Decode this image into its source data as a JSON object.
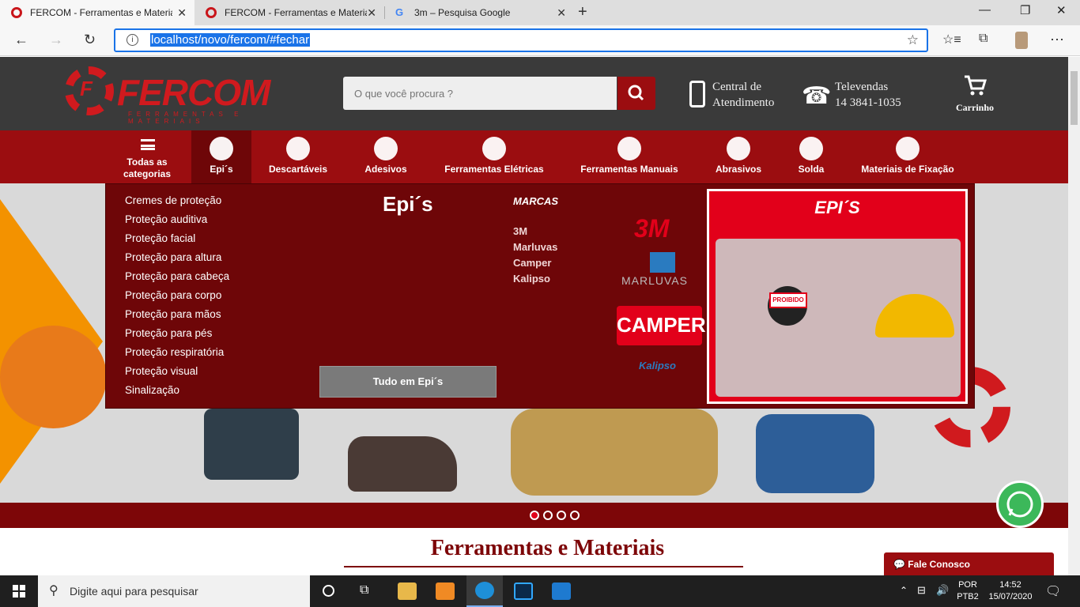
{
  "browser": {
    "tabs": [
      {
        "title": "FERCOM - Ferramentas e Materiais"
      },
      {
        "title": "FERCOM - Ferramentas e Materiais"
      },
      {
        "title": "3m – Pesquisa Google"
      }
    ],
    "url": "localhost/novo/fercom/#fechar"
  },
  "header": {
    "logo_text": "FERCOM",
    "logo_sub": "FERRAMENTAS E MATERIAIS",
    "search_placeholder": "O que você procura ?",
    "central_line1": "Central de",
    "central_line2": "Atendimento",
    "televendas_label": "Televendas",
    "televendas_phone": "14 3841-1035",
    "cart_label": "Carrinho"
  },
  "categories": {
    "all_line1": "Todas as",
    "all_line2": "categorias",
    "items": [
      "Epi´s",
      "Descartáveis",
      "Adesivos",
      "Ferramentas Elétricas",
      "Ferramentas Manuais",
      "Abrasivos",
      "Solda",
      "Materiais de Fixação"
    ]
  },
  "dropdown": {
    "title": "Epi´s",
    "subcategories": [
      "Cremes de proteção",
      "Proteção auditiva",
      "Proteção facial",
      "Proteção para altura",
      "Proteção para cabeça",
      "Proteção para corpo",
      "Proteção para mãos",
      "Proteção para pés",
      "Proteção respiratória",
      "Proteção visual",
      "Sinalização"
    ],
    "brands_title": "MARCAS",
    "brands": [
      "3M",
      "Marluvas",
      "Camper",
      "Kalipso"
    ],
    "logo_3m": "3M",
    "logo_marluvas": "MARLUVAS",
    "logo_camper": "CAMPER",
    "logo_kalipso": "Kalipso",
    "button": "Tudo em Epi´s",
    "promo_title": "EPI´S",
    "promo_sign": "PROIBIDO"
  },
  "section_title": "Ferramentas e Materiais",
  "contact_button": "Fale Conosco",
  "taskbar": {
    "search_placeholder": "Digite aqui para pesquisar",
    "lang1": "POR",
    "lang2": "PTB2",
    "time": "14:52",
    "date": "15/07/2020"
  },
  "colors": {
    "brand_red": "#9b0d10",
    "menu_dark": "#6e0608",
    "header_dark": "#3a3a3a"
  }
}
